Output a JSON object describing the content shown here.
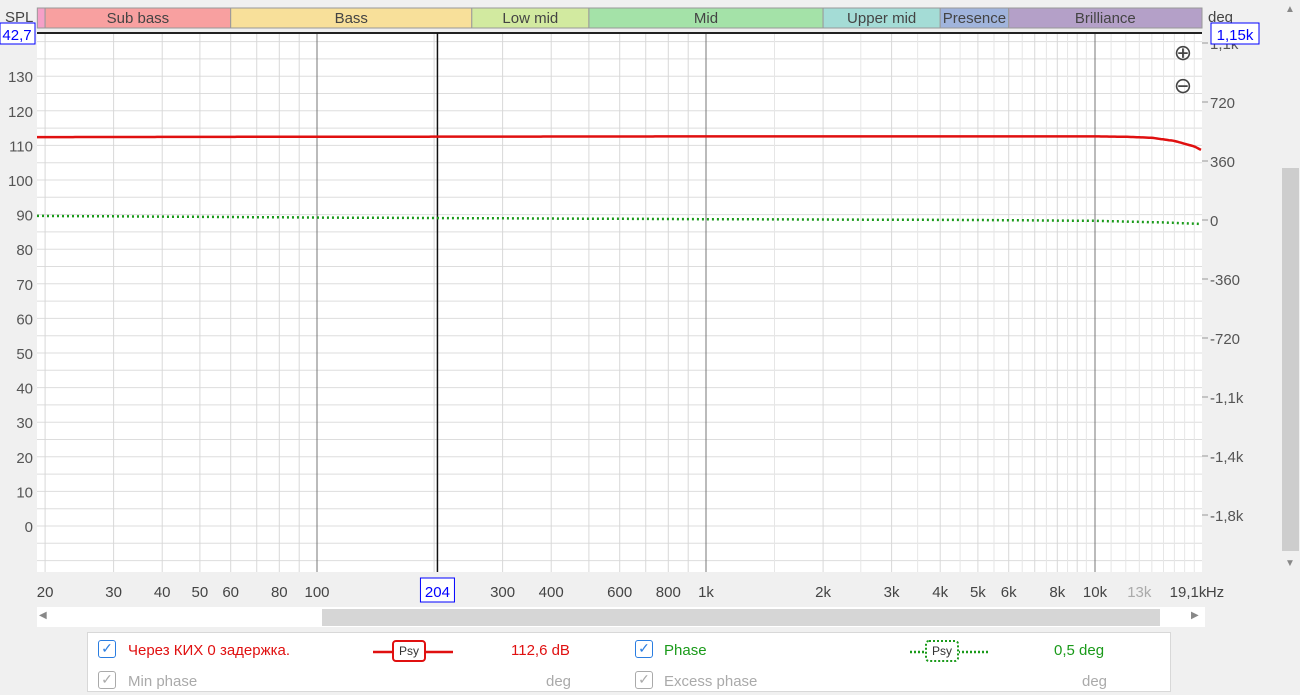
{
  "axes": {
    "left_title": "SPL",
    "right_title": "deg",
    "left_cursor_value": "42,7",
    "right_cursor_value": "1,15k",
    "x_cursor_value": "204",
    "left_ticks": [
      "130",
      "120",
      "110",
      "100",
      "90",
      "80",
      "70",
      "60",
      "50",
      "40",
      "30",
      "20",
      "10",
      "0"
    ],
    "right_ticks": [
      "1,1k",
      "720",
      "360",
      "0",
      "-360",
      "-720",
      "-1,1k",
      "-1,4k",
      "-1,8k"
    ],
    "x_ticks": [
      "20",
      "30",
      "40",
      "50",
      "60",
      "80",
      "100",
      "300",
      "400",
      "600",
      "800",
      "1k",
      "2k",
      "3k",
      "4k",
      "5k",
      "6k",
      "8k",
      "10k",
      "13k",
      "19,1k"
    ],
    "x_unit": "Hz"
  },
  "bands": [
    {
      "label": "",
      "color": "#f5a0c8"
    },
    {
      "label": "Sub bass",
      "color": "#f8a0a0"
    },
    {
      "label": "Bass",
      "color": "#f8e09a"
    },
    {
      "label": "Low mid",
      "color": "#d2eaa0"
    },
    {
      "label": "Mid",
      "color": "#a4e2a8"
    },
    {
      "label": "Upper mid",
      "color": "#a4dcd6"
    },
    {
      "label": "Presence",
      "color": "#a0b4dc"
    },
    {
      "label": "Brilliance",
      "color": "#b4a0c8"
    }
  ],
  "chart_data": {
    "type": "line",
    "xscale": "log",
    "xlim": [
      19.1,
      19100
    ],
    "ylim": [
      -13.3,
      142.7
    ],
    "y2lim": [
      -2040,
      1150
    ],
    "cursor_hz": 204,
    "series": [
      {
        "name": "Через КИХ 0 задержка.",
        "color": "#e01010",
        "style": "solid",
        "axis": "SPL",
        "x": [
          19.1,
          100,
          1000,
          5000,
          10000,
          12000,
          14000,
          16000,
          18000,
          19100
        ],
        "y": [
          112.4,
          112.5,
          112.6,
          112.6,
          112.6,
          112.5,
          112.2,
          111.3,
          109.7,
          108.2
        ]
      },
      {
        "name": "Phase",
        "color": "#1a9a1a",
        "style": "dotted",
        "axis": "deg",
        "x": [
          19.1,
          100,
          1000,
          5000,
          10000,
          15000,
          19100
        ],
        "y": [
          25,
          15,
          5,
          0,
          -5,
          -15,
          -25
        ]
      }
    ]
  },
  "legend": [
    {
      "label": "Через КИХ 0 задержка.",
      "badge": "Psy",
      "value": "112,6 dB",
      "checked": true,
      "color": "#e01010"
    },
    {
      "label": "Phase",
      "badge": "Psy",
      "value": "0,5 deg",
      "checked": true,
      "color": "#1a9a1a"
    },
    {
      "label": "Min phase",
      "value": "deg",
      "checked": true,
      "disabled": true
    },
    {
      "label": "Excess phase",
      "value": "deg",
      "checked": true,
      "disabled": true
    }
  ],
  "controls": {
    "zoom_in": "⊕",
    "zoom_out": "⊖"
  }
}
